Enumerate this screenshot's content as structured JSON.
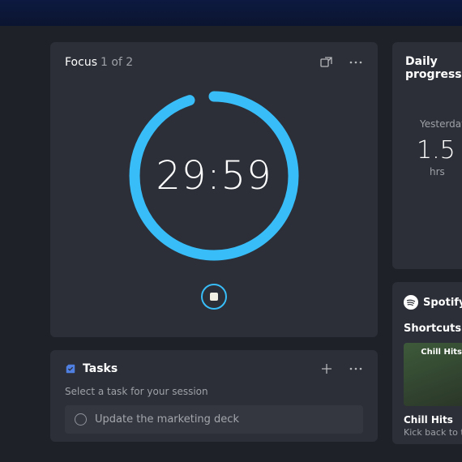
{
  "focus": {
    "title": "Focus",
    "progress": "1 of 2",
    "time": "29:59",
    "ring_percent": 95
  },
  "tasks": {
    "title": "Tasks",
    "subtitle": "Select a task for your session",
    "items": [
      "Update the marketing deck"
    ]
  },
  "daily": {
    "title": "Daily progress",
    "label": "Yesterday",
    "value": "1.5",
    "unit": "hrs"
  },
  "spotify": {
    "brand": "Spotify",
    "section": "Shortcuts",
    "album": {
      "badge": "Chill Hits",
      "title": "Chill Hits",
      "subtitle": "Kick back to t"
    }
  }
}
